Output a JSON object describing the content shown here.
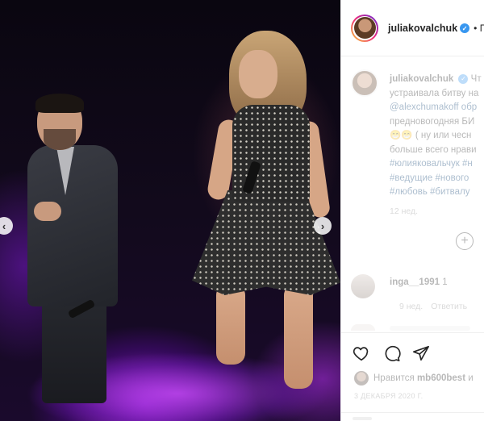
{
  "post": {
    "username": "juliakovalchuk",
    "header_separator": "• П",
    "caption": {
      "username": "juliakovalchuk",
      "lines": [
        "Чт",
        "устраивала битву на",
        "@alexchumakoff обр",
        "предновогодняя БИ",
        "😁😁 ( ну или чесн",
        "больше всего нрави",
        "#юлияковальчук #н",
        "#ведущие #нового",
        "#любовь #битвалу"
      ],
      "time_ago": "12 нед."
    },
    "comment": {
      "username": "inga__1991",
      "text": "1",
      "time_ago": "9 нед.",
      "reply_label": "Ответить"
    },
    "likes": {
      "prefix": "Нравится",
      "user": "mb600best",
      "suffix": "и"
    },
    "date": "3 ДЕКАБРЯ 2020 Г."
  },
  "icons": {
    "verified": "verified-badge-icon",
    "like": "heart-icon",
    "comment": "comment-icon",
    "share": "share-icon",
    "add": "plus-circle-icon",
    "prev": "chevron-left-icon",
    "next": "chevron-right-icon"
  },
  "colors": {
    "verified": "#3897f0",
    "link": "#00376b",
    "muted": "#8e8e8e",
    "text": "#262626"
  }
}
